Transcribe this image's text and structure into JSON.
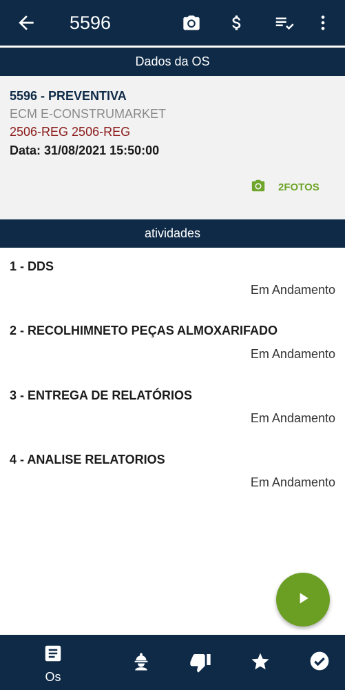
{
  "appbar": {
    "title": "5596",
    "icons": [
      "back-arrow-icon",
      "camera-icon",
      "dollar-icon",
      "checklist-icon",
      "more-vert-icon"
    ]
  },
  "os_header": "Dados da OS",
  "os": {
    "line1": "5596 - PREVENTIVA",
    "line2": "ECM E-CONSTRUMARKET",
    "line3": "2506-REG 2506-REG",
    "line4": "Data: 31/08/2021 15:50:00",
    "photos_label": "2FOTOS"
  },
  "activities_header": "atividades",
  "activities": [
    {
      "title": "1 - DDS",
      "status": "Em Andamento"
    },
    {
      "title": "2 - RECOLHIMNETO PEÇAS ALMOXARIFADO",
      "status": "Em Andamento"
    },
    {
      "title": "3 - ENTREGA DE RELATÓRIOS",
      "status": "Em Andamento"
    },
    {
      "title": "4 - ANALISE RELATORIOS",
      "status": "Em Andamento"
    }
  ],
  "bottom_nav": {
    "os_label": "Os"
  },
  "colors": {
    "primary": "#0e2a47",
    "accent_green": "#6a9f24",
    "dark_red": "#8b1a1a"
  }
}
